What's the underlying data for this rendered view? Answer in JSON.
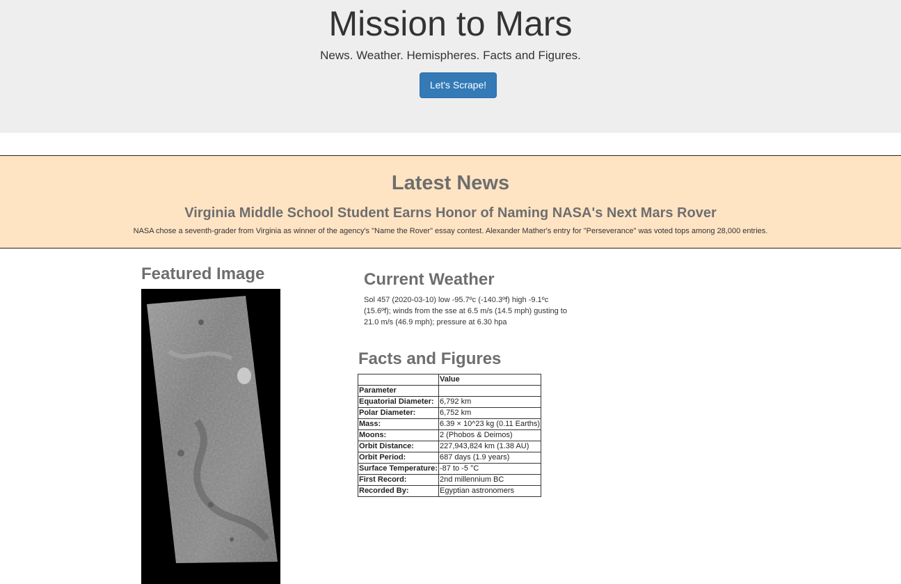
{
  "header": {
    "title": "Mission to Mars",
    "tagline": "News. Weather. Hemispheres. Facts and Figures.",
    "scrape_button": "Let's Scrape!"
  },
  "news": {
    "section_title": "Latest News",
    "headline": "Virginia Middle School Student Earns Honor of Naming NASA's Next Mars Rover",
    "teaser": "NASA chose a seventh-grader from Virginia as winner of the agency's \"Name the Rover\" essay contest. Alexander Mather's entry for \"Perseverance\" was voted tops among 28,000 entries."
  },
  "featured": {
    "section_title": "Featured Image",
    "image_alt": "Mars surface strip image"
  },
  "weather": {
    "section_title": "Current Weather",
    "text": "Sol 457 (2020-03-10) low -95.7ºc (-140.3ºf) high -9.1ºc (15.6ºf); winds from the sse at 6.5 m/s (14.5 mph) gusting to 21.0 m/s (46.9 mph); pressure at 6.30 hpa"
  },
  "facts": {
    "section_title": "Facts and Figures",
    "value_header": "Value",
    "param_header": "Parameter",
    "rows": [
      {
        "param": "Equatorial Diameter:",
        "value": "6,792 km"
      },
      {
        "param": "Polar Diameter:",
        "value": "6,752 km"
      },
      {
        "param": "Mass:",
        "value": "6.39 × 10^23 kg (0.11 Earths)"
      },
      {
        "param": "Moons:",
        "value": "2 (Phobos & Deimos)"
      },
      {
        "param": "Orbit Distance:",
        "value": "227,943,824 km (1.38 AU)"
      },
      {
        "param": "Orbit Period:",
        "value": "687 days (1.9 years)"
      },
      {
        "param": "Surface Temperature:",
        "value": "-87 to -5 °C"
      },
      {
        "param": "First Record:",
        "value": "2nd millennium BC"
      },
      {
        "param": "Recorded By:",
        "value": "Egyptian astronomers"
      }
    ]
  }
}
